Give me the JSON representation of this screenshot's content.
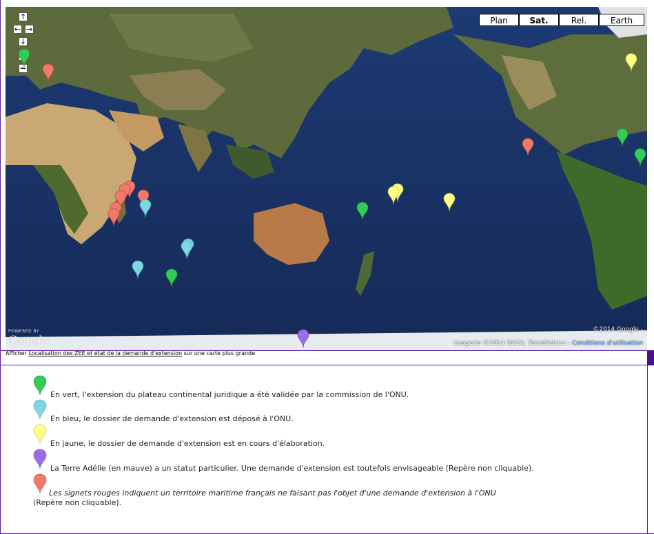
{
  "map": {
    "map_types": [
      {
        "label": "Plan",
        "active": false
      },
      {
        "label": "Sat.",
        "active": true
      },
      {
        "label": "Rel.",
        "active": false
      },
      {
        "label": "Earth",
        "active": false
      }
    ],
    "nav": {
      "up": "↑",
      "left": "←",
      "right": "→",
      "down": "↓"
    },
    "zoom": {
      "in": "+",
      "out": "−"
    },
    "copyright": "©2014 Google -",
    "imagery": "Imagerie ©2014 NASA, TerraMetrics -",
    "terms_link": "Conditions d'utilisation",
    "powered_by": "POWERED BY",
    "google": "Google",
    "colors": {
      "green": "#33cc55",
      "blue": "#7fd6e0",
      "yellow": "#ffff88",
      "purple": "#9a6ee8",
      "red": "#f07a6a"
    }
  },
  "footer_link": {
    "prefix": "Afficher",
    "link": "Localisation des ZEE et état de la demande d'extension",
    "suffix": "sur une carte plus grande"
  },
  "legend": [
    {
      "color": "green",
      "text": "En vert, l'extension du plateau continental juridique a été validée par la commission de l'ONU."
    },
    {
      "color": "blue",
      "text": "En bleu, le dossier de demande d'extension est déposé à l'ONU."
    },
    {
      "color": "yellow",
      "text": "En jaune, le dossier de demande d'extension est en cours d'élaboration."
    },
    {
      "color": "purple",
      "text": "La Terre Adélie (en mauve) a un statut particulier. Une demande d'extension est toutefois envisageable (Repère non cliquable)."
    },
    {
      "color": "red",
      "text_line1": "Les signets rouges indiquent un territoire maritime français ne faisant pas l'objet d'une demande d'extension à l'ONU",
      "text_line2": "(Repère non cliquable)."
    }
  ]
}
